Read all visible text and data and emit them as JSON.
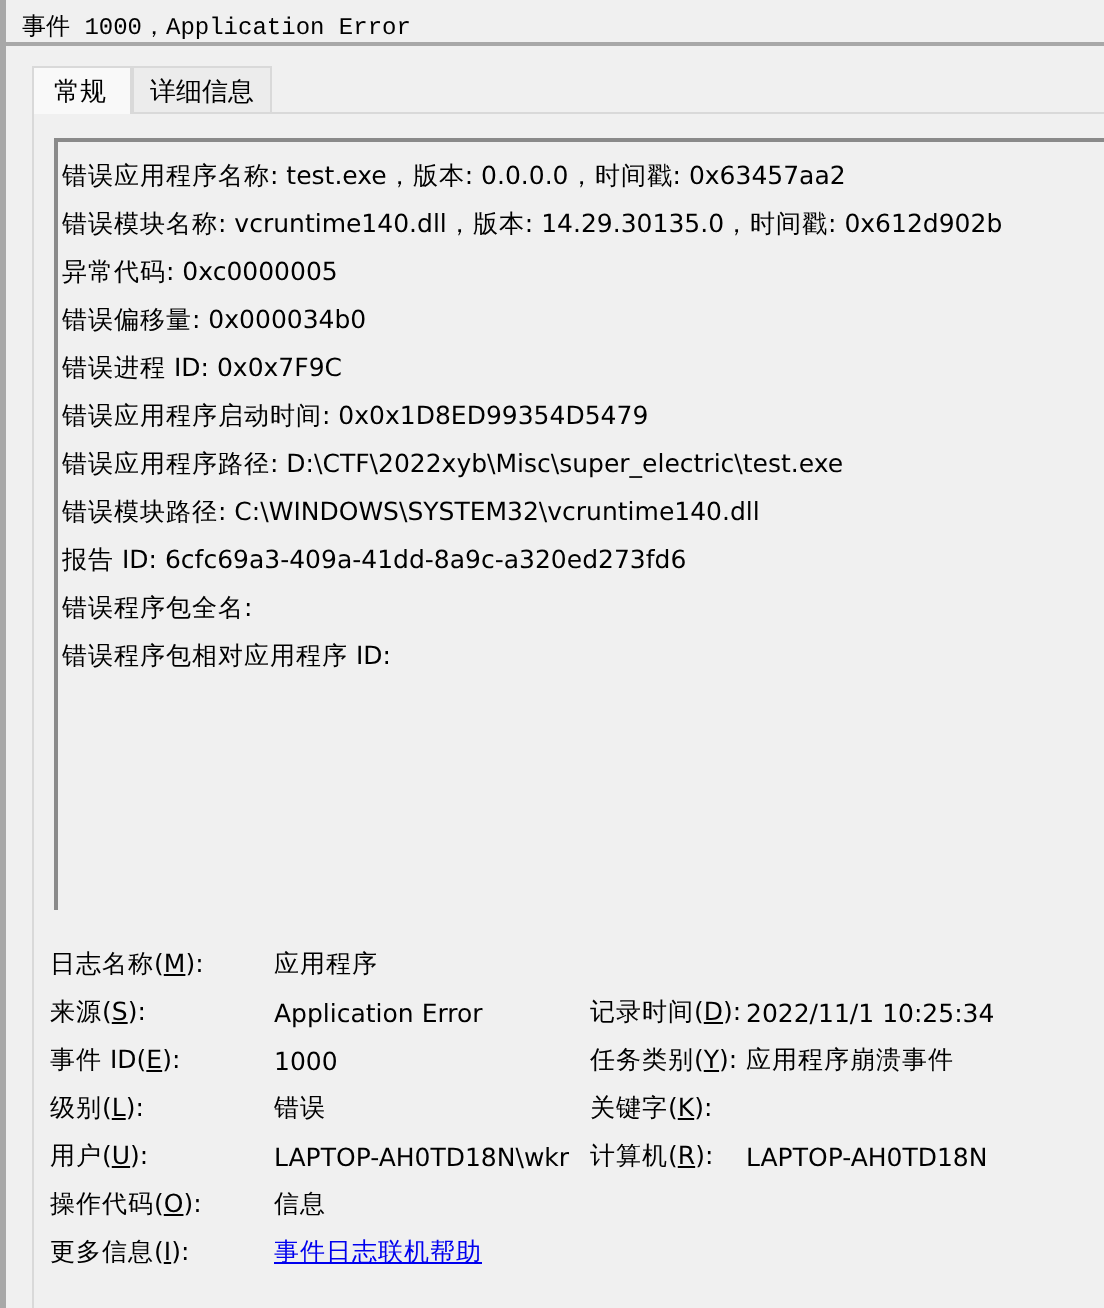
{
  "window": {
    "title": "事件 1000，Application Error"
  },
  "tabs": [
    {
      "label": "常规",
      "selected": true
    },
    {
      "label": "详细信息",
      "selected": false
    }
  ],
  "description": [
    "错误应用程序名称: test.exe，版本: 0.0.0.0，时间戳: 0x63457aa2",
    "错误模块名称: vcruntime140.dll，版本: 14.29.30135.0，时间戳: 0x612d902b",
    "异常代码: 0xc0000005",
    "错误偏移量: 0x000034b0",
    "错误进程 ID: 0x0x7F9C",
    "错误应用程序启动时间: 0x0x1D8ED99354D5479",
    "错误应用程序路径: D:\\CTF\\2022xyb\\Misc\\super_electric\\test.exe",
    "错误模块路径: C:\\WINDOWS\\SYSTEM32\\vcruntime140.dll",
    "报告 ID: 6cfc69a3-409a-41dd-8a9c-a320ed273fd6",
    "错误程序包全名:",
    "错误程序包相对应用程序 ID:"
  ],
  "properties": [
    {
      "left": {
        "label": "日志名称(M):",
        "value": "应用程序"
      }
    },
    {
      "left": {
        "label": "来源(S):",
        "value": "Application Error"
      },
      "right": {
        "label": "记录时间(D):",
        "value": "2022/11/1 10:25:34"
      }
    },
    {
      "left": {
        "label": "事件 ID(E):",
        "value": "1000"
      },
      "right": {
        "label": "任务类别(Y):",
        "value": "应用程序崩溃事件"
      }
    },
    {
      "left": {
        "label": "级别(L):",
        "value": "错误"
      },
      "right": {
        "label": "关键字(K):"
      }
    },
    {
      "left": {
        "label": "用户(U):",
        "value": "LAPTOP-AH0TD18N\\wkr"
      },
      "right": {
        "label": "计算机(R):",
        "value": "LAPTOP-AH0TD18N"
      }
    },
    {
      "left": {
        "label": "操作代码(O):",
        "value": "信息"
      }
    },
    {
      "left": {
        "label": "更多信息(I):",
        "link": "事件日志联机帮助"
      }
    }
  ]
}
